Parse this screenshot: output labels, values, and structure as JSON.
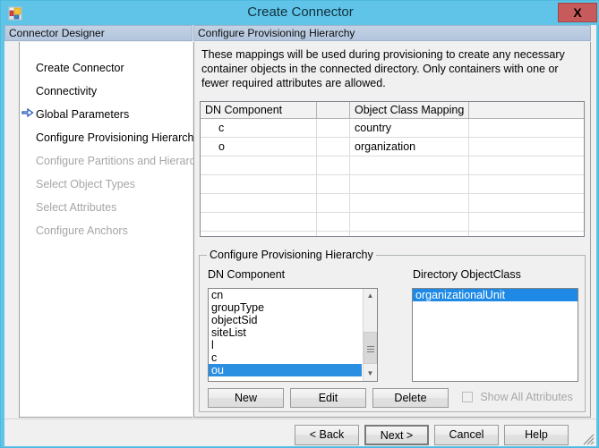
{
  "window": {
    "title": "Create Connector",
    "close_label": "X",
    "icon": "connector-app-icon",
    "frame_color": "#5fc4e8",
    "close_color": "#c75b5b"
  },
  "left_pane": {
    "header": "Connector Designer",
    "items": [
      {
        "label": "Create Connector",
        "state": "done",
        "current": false
      },
      {
        "label": "Connectivity",
        "state": "done",
        "current": false
      },
      {
        "label": "Global Parameters",
        "state": "done",
        "current": false
      },
      {
        "label": "Configure Provisioning Hierarchy",
        "state": "current",
        "current": true
      },
      {
        "label": "Configure Partitions and Hierarchies",
        "state": "disabled",
        "current": false
      },
      {
        "label": "Select Object Types",
        "state": "disabled",
        "current": false
      },
      {
        "label": "Select Attributes",
        "state": "disabled",
        "current": false
      },
      {
        "label": "Configure Anchors",
        "state": "disabled",
        "current": false
      }
    ],
    "current_arrow_icon": "right-arrow-icon"
  },
  "right_pane": {
    "header": "Configure Provisioning Hierarchy",
    "description": "These mappings will be used during provisioning to create any necessary container objects in the connected directory.  Only containers with one or fewer required attributes are allowed.",
    "grid": {
      "columns": [
        "DN Component",
        "",
        "Object Class Mapping",
        ""
      ],
      "rows": [
        {
          "dn_component": "c",
          "spacer": "",
          "object_class_mapping": "country",
          "extra": ""
        },
        {
          "dn_component": "o",
          "spacer": "",
          "object_class_mapping": "organization",
          "extra": ""
        }
      ],
      "empty_row_count": 5
    },
    "groupbox": {
      "title": "Configure Provisioning Hierarchy",
      "dn_component_label": "DN Component",
      "directory_objectclass_label": "Directory ObjectClass",
      "dn_component_items": [
        "cn",
        "groupType",
        "objectSid",
        "siteList",
        "l",
        "c",
        "ou"
      ],
      "dn_component_selected": "ou",
      "directory_objectclass_items": [
        "organizationalUnit"
      ],
      "directory_objectclass_selected": "organizationalUnit",
      "selection_color": "#2a8fe0",
      "buttons": {
        "new": "New",
        "edit": "Edit",
        "delete": "Delete"
      },
      "show_all_attributes": {
        "label": "Show All Attributes",
        "checked": false,
        "enabled": false
      }
    }
  },
  "bottom_bar": {
    "back": "< Back",
    "next": "Next  >",
    "cancel": "Cancel",
    "help": "Help",
    "default_button": "next"
  }
}
